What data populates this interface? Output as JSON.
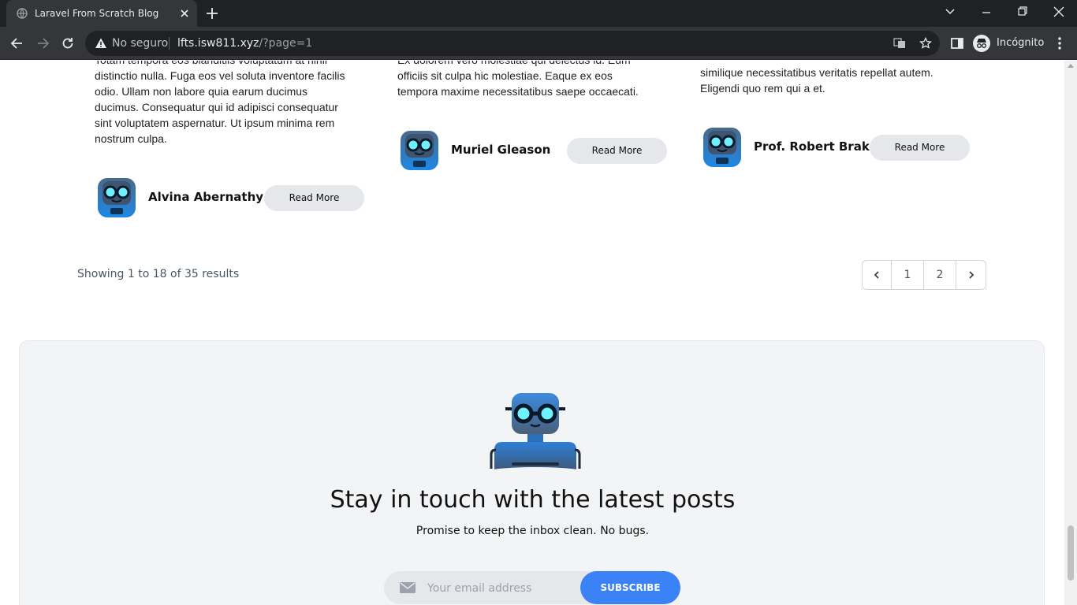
{
  "browser": {
    "tab_title": "Laravel From Scratch Blog",
    "security_label": "No seguro",
    "url_host": "lfts.isw811.xyz",
    "url_path": "/?page=1",
    "profile_label": "Incógnito"
  },
  "posts": [
    {
      "excerpt": "Totam tempora eos blanditiis voluptatum at nihil\ndistinctio nulla. Fuga eos vel soluta inventore facilis\nodio. Ullam non labore quia earum ducimus\nducimus. Consequatur qui id adipisci consequatur\nsint voluptatem aspernatur. Ut ipsum minima rem\nnostrum culpa.",
      "author": "Alvina Abernathy",
      "read_more": "Read More"
    },
    {
      "excerpt": "Ex dolorem vero molestiae qui delectus id. Eum\nofficiis sit culpa hic molestiae. Eaque ex eos\ntempora maxime necessitatibus saepe occaecati.",
      "author": "Muriel Gleason",
      "read_more": "Read More"
    },
    {
      "excerpt": "similique necessitatibus veritatis repellat autem.\nEligendi quo rem qui a et.",
      "author": "Prof. Robert Brakus",
      "read_more": "Read More"
    }
  ],
  "pagination": {
    "summary": "Showing 1 to 18 of 35 results",
    "pages": [
      "1",
      "2"
    ]
  },
  "newsletter": {
    "title": "Stay in touch with the latest posts",
    "subtitle": "Promise to keep the inbox clean. No bugs.",
    "email_placeholder": "Your email address",
    "subscribe_label": "SUBSCRIBE"
  },
  "colors": {
    "accent": "#3b82f6",
    "button_bg": "#e5e7eb",
    "panel_bg": "#f3f4f6"
  },
  "icons": {
    "avatar": "robot-avatar-icon",
    "mail": "mail-icon"
  }
}
